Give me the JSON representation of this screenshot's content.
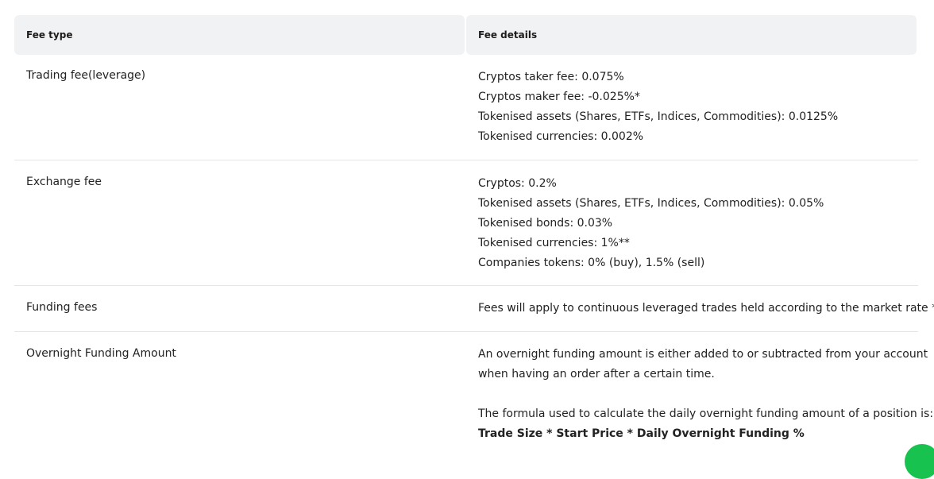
{
  "header": {
    "fee_type": "Fee type",
    "fee_details": "Fee details"
  },
  "rows": [
    {
      "type": "Trading fee(leverage)",
      "details": [
        "Cryptos taker fee: 0.075%",
        "Cryptos maker fee: -0.025%*",
        "Tokenised assets (Shares, ETFs, Indices, Commodities): 0.0125%",
        "Tokenised currencies: 0.002%"
      ]
    },
    {
      "type": "Exchange fee",
      "details": [
        "Cryptos: 0.2%",
        "Tokenised assets (Shares, ETFs, Indices, Commodities): 0.05%",
        "Tokenised bonds: 0.03%",
        "Tokenised currencies: 1%**",
        "Companies tokens: 0% (buy), 1.5% (sell)"
      ]
    },
    {
      "type": "Funding fees",
      "details": [
        "Fees will apply to continuous leveraged trades held according to the market rate ***"
      ]
    },
    {
      "type": "Overnight Funding Amount",
      "details": [
        "An overnight funding amount is either added to or subtracted from your account",
        "when having an order after a certain time.",
        "The formula used to calculate the daily overnight funding amount of a position is:"
      ],
      "formula": "Trade Size * Start Price * Daily Overnight Funding %"
    }
  ],
  "chat_widget": {
    "icon": "chat-bubble-icon",
    "color": "#17c24f"
  }
}
